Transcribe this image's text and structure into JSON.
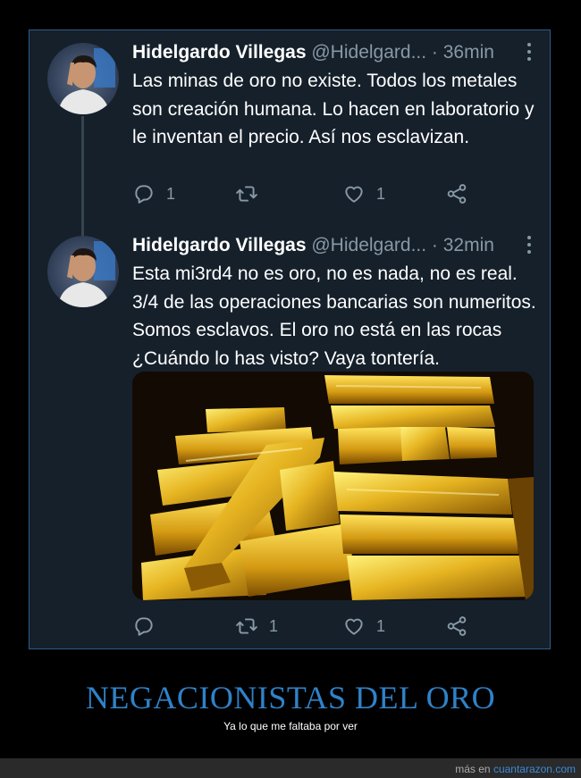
{
  "tweets": [
    {
      "name": "Hidelgardo Villegas",
      "handle": "@Hidelgard...",
      "time": "· 36min",
      "text": "Las minas de oro no existe. Todos los metales son creación humana. Lo hacen en laboratorio y le inventan el precio. Así nos esclavizan.",
      "replies": "1",
      "retweets": "",
      "likes": "1"
    },
    {
      "name": "Hidelgardo Villegas",
      "handle": "@Hidelgard...",
      "time": "· 32min",
      "text": "Esta mi3rd4 no es oro, no es nada, no es real. 3/4 de las operaciones bancarias son numeritos. Somos esclavos. El oro no está en las rocas ¿Cuándo lo has visto? Vaya tontería.",
      "replies": "",
      "retweets": "1",
      "likes": "1"
    }
  ],
  "footer": {
    "title": "NEGACIONISTAS DEL ORO",
    "subtitle": "Ya lo que me faltaba por ver",
    "credit_prefix": "más en",
    "credit_site": "cuantarazon.com"
  },
  "icons": [
    "reply-icon",
    "retweet-icon",
    "like-icon",
    "share-icon",
    "more-icon"
  ],
  "colors": {
    "background": "#15202b",
    "frame_border": "#2f5a86",
    "muted": "#8899a6",
    "accent": "#2f82c8"
  }
}
